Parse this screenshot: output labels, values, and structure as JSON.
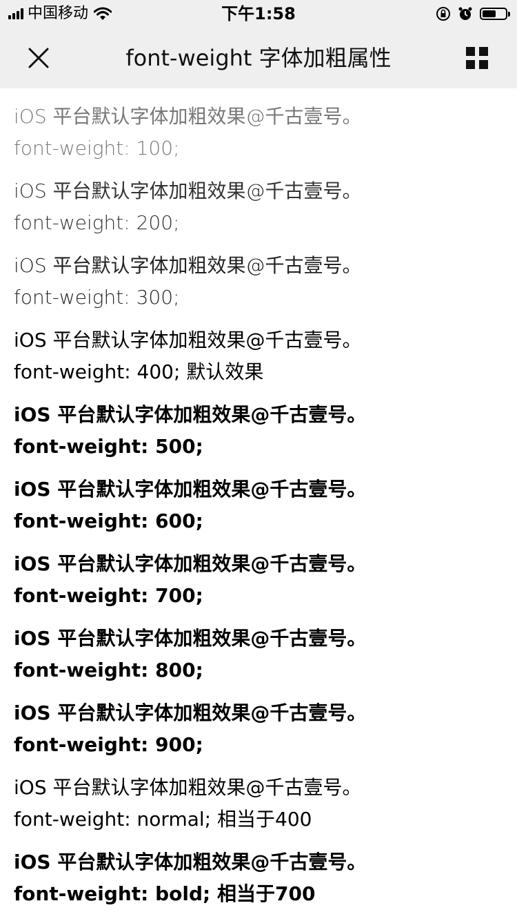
{
  "status_bar": {
    "carrier": "中国移动",
    "time": "下午1:58",
    "battery_level": 0.6
  },
  "nav": {
    "title": "font-weight 字体加粗属性",
    "close_icon": "close-icon",
    "more_icon": "grid-menu-icon"
  },
  "items": [
    {
      "text": "iOS 平台默认字体加粗效果@千古壹号。",
      "rule": "font-weight: 100;"
    },
    {
      "text": "iOS 平台默认字体加粗效果@千古壹号。",
      "rule": "font-weight: 200;"
    },
    {
      "text": "iOS 平台默认字体加粗效果@千古壹号。",
      "rule": "font-weight: 300;"
    },
    {
      "text": "iOS 平台默认字体加粗效果@千古壹号。",
      "rule": "font-weight: 400; 默认效果"
    },
    {
      "text": "iOS 平台默认字体加粗效果@千古壹号。",
      "rule": "font-weight: 500;"
    },
    {
      "text": "iOS 平台默认字体加粗效果@千古壹号。",
      "rule": "font-weight: 600;"
    },
    {
      "text": "iOS 平台默认字体加粗效果@千古壹号。",
      "rule": "font-weight: 700;"
    },
    {
      "text": "iOS 平台默认字体加粗效果@千古壹号。",
      "rule": "font-weight: 800;"
    },
    {
      "text": "iOS 平台默认字体加粗效果@千古壹号。",
      "rule": "font-weight: 900;"
    },
    {
      "text": "iOS 平台默认字体加粗效果@千古壹号。",
      "rule": "font-weight: normal; 相当于400"
    },
    {
      "text": "iOS 平台默认字体加粗效果@千古壹号。",
      "rule": "font-weight: bold; 相当于700"
    }
  ]
}
